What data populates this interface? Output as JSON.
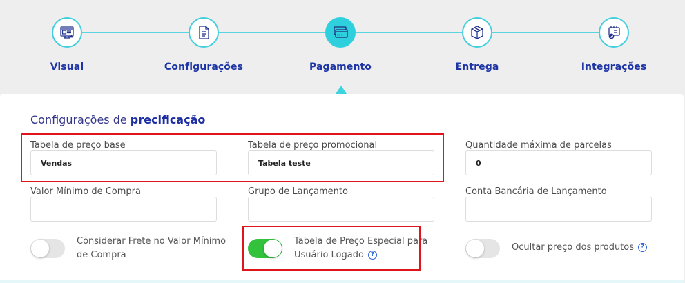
{
  "stepper": {
    "steps": [
      {
        "label": "Visual",
        "icon": "visual-layout-icon",
        "active": false
      },
      {
        "label": "Configurações",
        "icon": "document-icon",
        "active": false
      },
      {
        "label": "Pagamento",
        "icon": "credit-card-icon",
        "active": true
      },
      {
        "label": "Entrega",
        "icon": "box-icon",
        "active": false
      },
      {
        "label": "Integrações",
        "icon": "integration-gear-icon",
        "active": false
      }
    ]
  },
  "section": {
    "title_prefix": "Configurações de ",
    "title_bold": "precificação"
  },
  "fields": {
    "tabela_base": {
      "label": "Tabela de preço base",
      "value": "Vendas"
    },
    "tabela_promocional": {
      "label": "Tabela de preço promocional",
      "value": "Tabela teste"
    },
    "parcelas": {
      "label": "Quantidade máxima de parcelas",
      "value": "0"
    },
    "valor_minimo": {
      "label": "Valor Mínimo de Compra",
      "value": ""
    },
    "grupo_lancamento": {
      "label": "Grupo de Lançamento",
      "value": ""
    },
    "conta_bancaria": {
      "label": "Conta Bancária de Lançamento",
      "value": ""
    }
  },
  "toggles": {
    "considerar_frete": {
      "line1": "Considerar Frete no Valor Mínimo",
      "line2": "de Compra",
      "on": false
    },
    "tabela_especial": {
      "line1": "Tabela de Preço Especial para",
      "line2": "Usuário Logado",
      "on": true
    },
    "ocultar_preco": {
      "label": "Ocultar preço dos produtos",
      "on": false
    }
  },
  "help_glyph": "?",
  "colors": {
    "accent": "#2fd0de",
    "title_blue": "#1e35a5",
    "toggle_on": "#32c23c",
    "highlight": "#e0151c",
    "help_blue": "#2b61d6"
  }
}
